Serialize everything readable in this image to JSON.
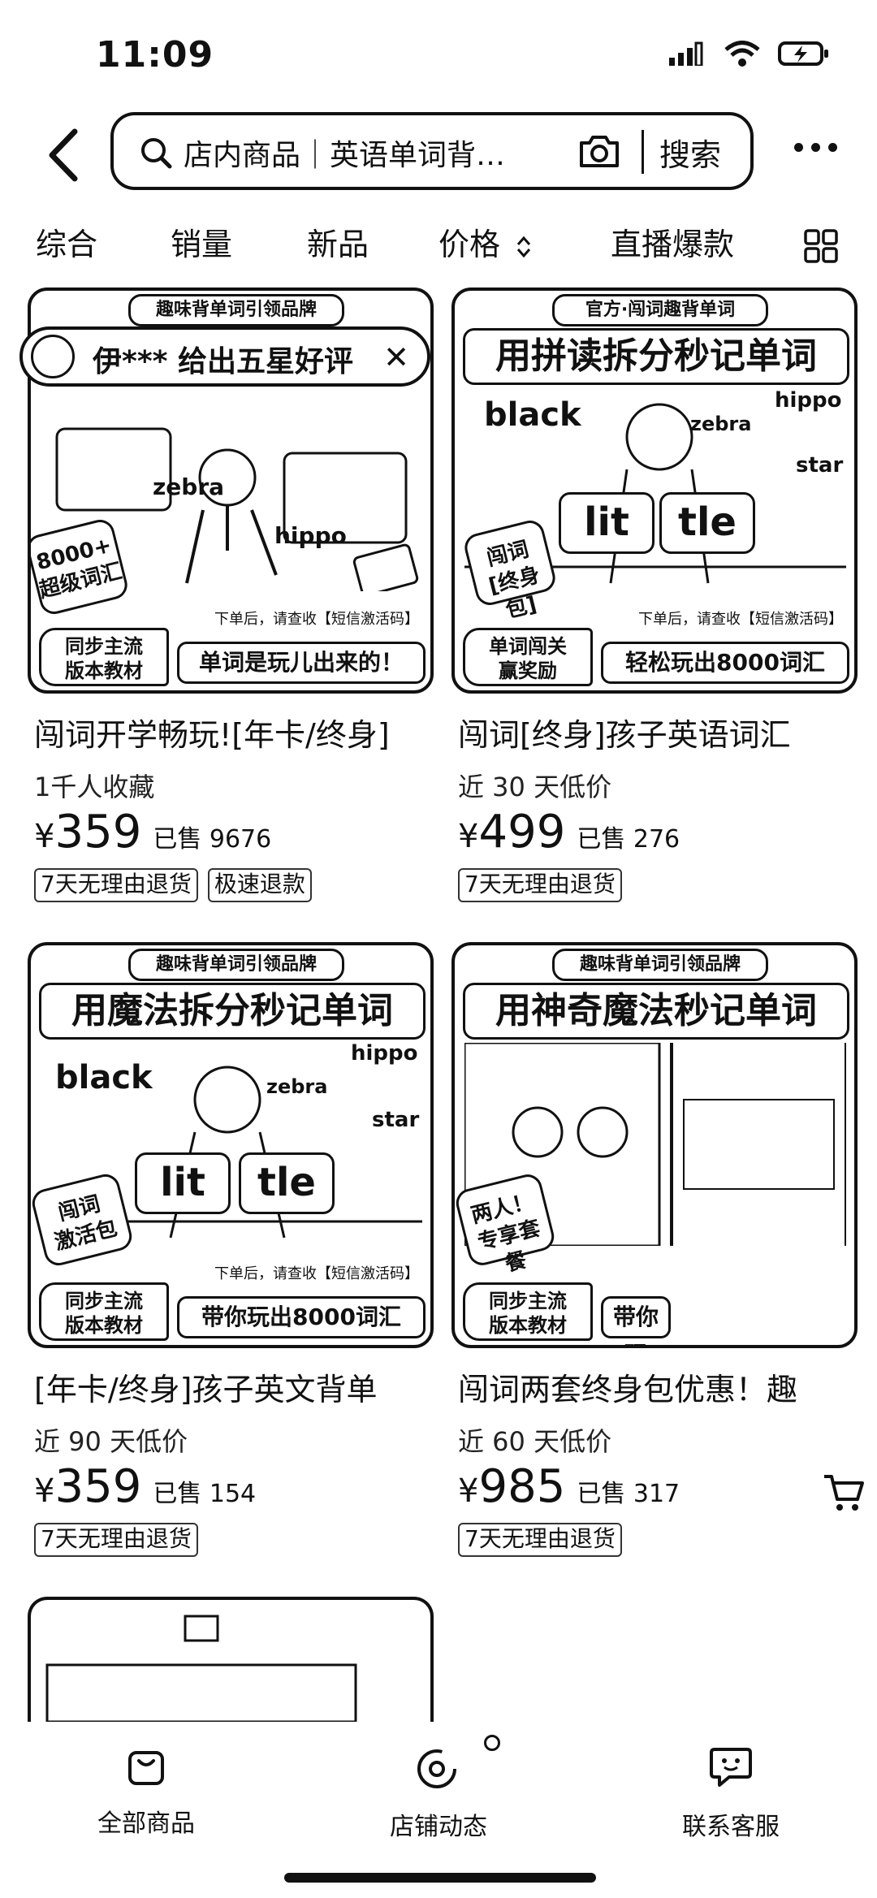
{
  "status": {
    "time": "11:09"
  },
  "search": {
    "text": "店内商品｜英语单词背…",
    "button": "搜索"
  },
  "tabs": [
    {
      "label": "综合"
    },
    {
      "label": "销量"
    },
    {
      "label": "新品"
    },
    {
      "label": "价格"
    },
    {
      "label": "直播爆款"
    }
  ],
  "toast": {
    "text": "伊*** 给出五星好评"
  },
  "products": [
    {
      "banner": "趣味背单词引领品牌",
      "headline": "",
      "words": [
        "zebra",
        "hippo"
      ],
      "tiles": [],
      "note": "下单后，请查收【短信激活码】",
      "badge": "同步主流\n版本教材",
      "slogan": "单词是玩儿出来的！",
      "stamp": "8000+\n超级词汇",
      "title": "闯词开学畅玩![年卡/终身]",
      "sub": "1千人收藏",
      "currency": "¥",
      "price": "359",
      "sold": "已售 9676",
      "tags": [
        "7天无理由退货",
        "极速退款"
      ]
    },
    {
      "banner": "官方·闯词趣背单词",
      "headline": "用拼读拆分秒记单词",
      "words": [
        "black",
        "zebra",
        "hippo",
        "star"
      ],
      "tiles": [
        "lit",
        "tle"
      ],
      "note": "下单后，请查收【短信激活码】",
      "badge": "单词闯关\n赢奖励",
      "slogan": "轻松玩出8000词汇",
      "stamp": "闯词\n[终身包]",
      "title": "闯词[终身]孩子英语词汇",
      "sub": "近 30 天低价",
      "currency": "¥",
      "price": "499",
      "sold": "已售 276",
      "tags": [
        "7天无理由退货"
      ]
    },
    {
      "banner": "趣味背单词引领品牌",
      "headline": "用魔法拆分秒记单词",
      "words": [
        "black",
        "zebra",
        "hippo",
        "star"
      ],
      "tiles": [
        "lit",
        "tle"
      ],
      "note": "下单后，请查收【短信激活码】",
      "badge": "同步主流\n版本教材",
      "slogan": "带你玩出8000词汇",
      "stamp": "闯词\n激活包",
      "title": "[年卡/终身]孩子英文背单",
      "sub": "近 90 天低价",
      "currency": "¥",
      "price": "359",
      "sold": "已售 154",
      "tags": [
        "7天无理由退货"
      ]
    },
    {
      "banner": "趣味背单词引领品牌",
      "headline": "用神奇魔法秒记单词",
      "words": [],
      "tiles": [],
      "note": "",
      "badge": "同步主流\n版本教材",
      "slogan": "带你玩",
      "stamp": "两人！\n专享套餐",
      "title": "闯词两套终身包优惠！趣",
      "sub": "近 60 天低价",
      "currency": "¥",
      "price": "985",
      "sold": "已售 317",
      "tags": [
        "7天无理由退货"
      ]
    }
  ],
  "nav": [
    {
      "label": "全部商品",
      "icon": "bag-icon"
    },
    {
      "label": "店铺动态",
      "icon": "store-activity-icon"
    },
    {
      "label": "联系客服",
      "icon": "chat-icon"
    }
  ]
}
